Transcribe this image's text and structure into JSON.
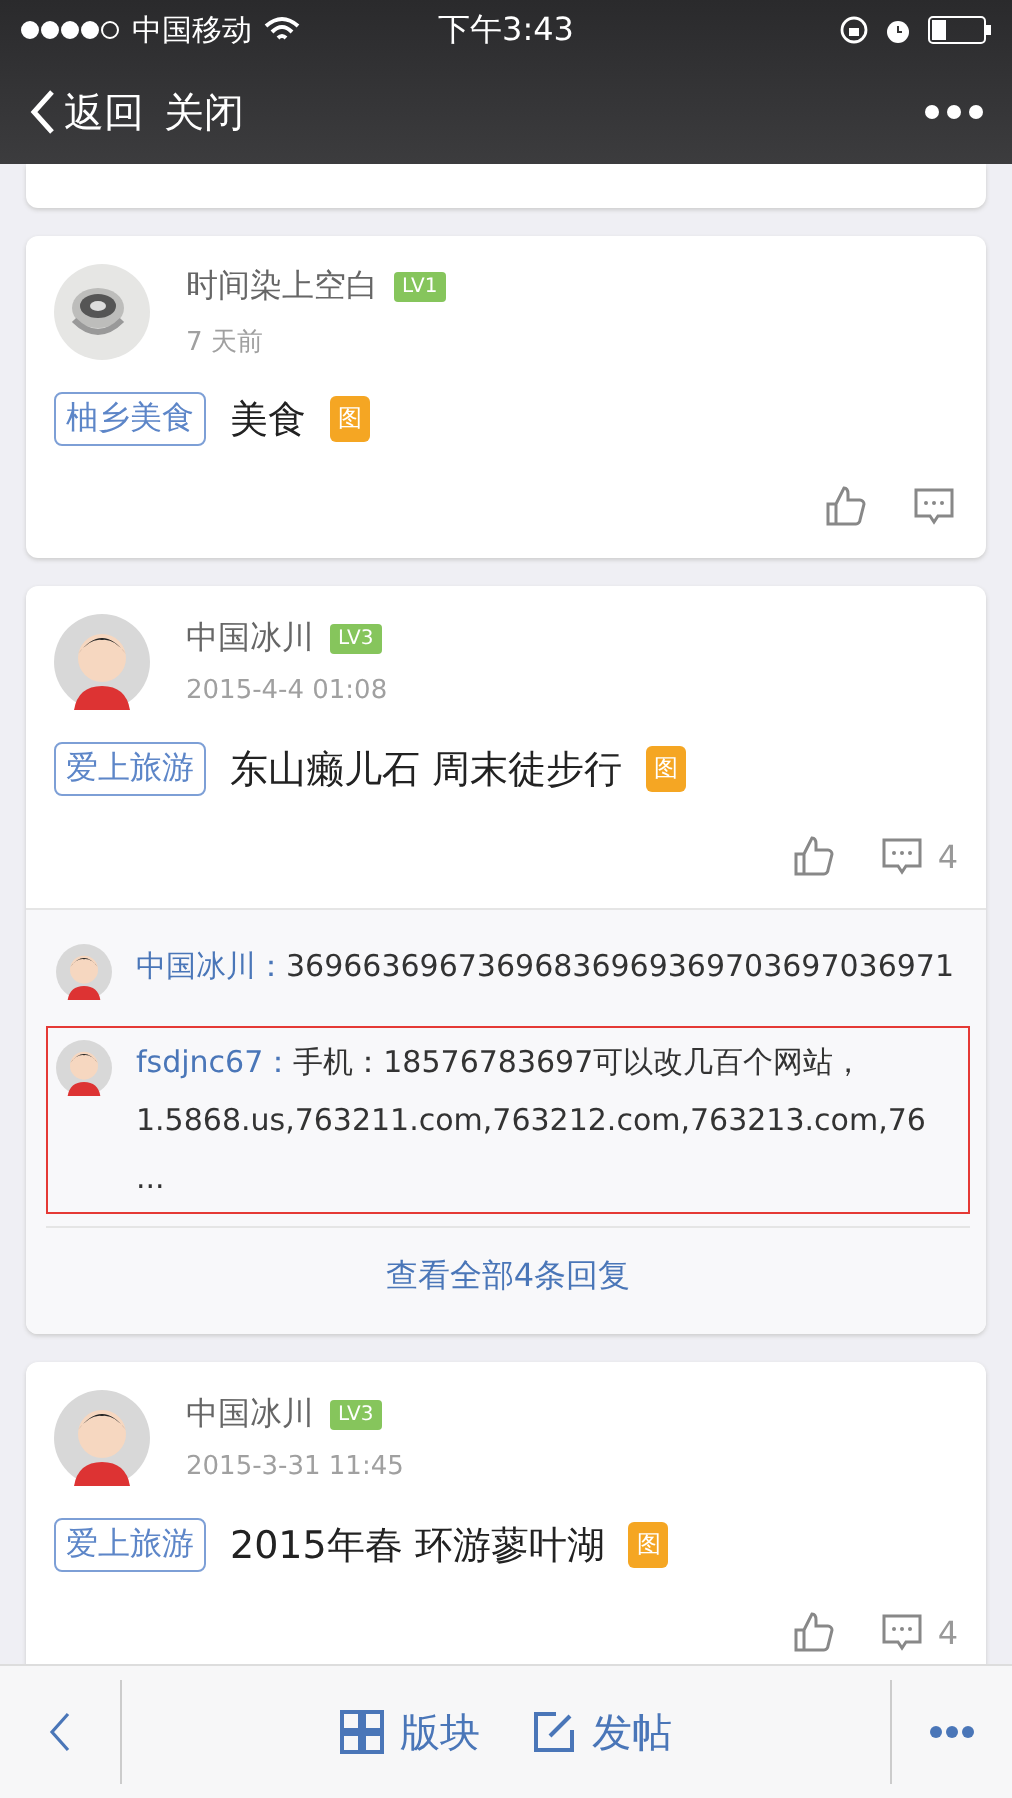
{
  "status_bar": {
    "carrier": "中国移动",
    "time": "下午3:43"
  },
  "nav": {
    "back": "返回",
    "close": "关闭"
  },
  "posts": [
    {
      "avatar": {
        "kind": "cup"
      },
      "user": "时间染上空白",
      "level": "LV1",
      "time": "7 天前",
      "forum": "柚乡美食",
      "title": "美食",
      "image_tag": "图"
    },
    {
      "avatar": {
        "kind": "figure"
      },
      "user": "中国冰川",
      "level": "LV3",
      "time": "2015-4-4 01:08",
      "forum": "爱上旅游",
      "title": "东山癞儿石 周末徒步行",
      "image_tag": "图",
      "comment_count": "4",
      "replies": [
        {
          "user": "中国冰川：",
          "lines": [
            "36966369673696836969369703697036971"
          ],
          "highlighted": false
        },
        {
          "user": "fsdjnc67：",
          "lines": [
            "手机：18576783697可以改几百个网站，",
            "1.5868.us,763211.com,763212.com,763213.com,76",
            "..."
          ],
          "highlighted": true
        }
      ],
      "more_replies": "查看全部4条回复"
    },
    {
      "avatar": {
        "kind": "figure"
      },
      "user": "中国冰川",
      "level": "LV3",
      "time": "2015-3-31 11:45",
      "forum": "爱上旅游",
      "title": "2015年春 环游蓼叶湖",
      "image_tag": "图",
      "comment_count": "4"
    }
  ],
  "bottom_bar": {
    "items": [
      "版块",
      "发帖"
    ]
  }
}
